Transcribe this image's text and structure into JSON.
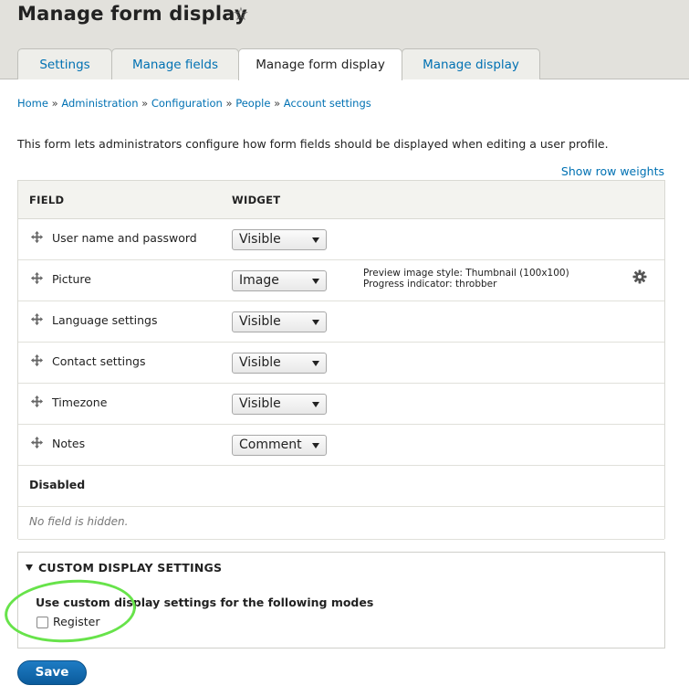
{
  "header": {
    "title": "Manage form display",
    "tabs": [
      {
        "label": "Settings",
        "active": false
      },
      {
        "label": "Manage fields",
        "active": false
      },
      {
        "label": "Manage form display",
        "active": true
      },
      {
        "label": "Manage display",
        "active": false
      }
    ]
  },
  "breadcrumb": [
    "Home",
    "Administration",
    "Configuration",
    "People",
    "Account settings"
  ],
  "breadcrumb_separator": "»",
  "description": "This form lets administrators configure how form fields should be displayed when editing a user profile.",
  "row_weights_link": "Show row weights",
  "table": {
    "headers": {
      "field": "FIELD",
      "widget": "WIDGET"
    },
    "rows": [
      {
        "label": "User name and password",
        "widget": "Visible",
        "summary": []
      },
      {
        "label": "Picture",
        "widget": "Image",
        "summary": [
          "Preview image style: Thumbnail (100x100)",
          "Progress indicator: throbber"
        ]
      },
      {
        "label": "Language settings",
        "widget": "Visible",
        "summary": []
      },
      {
        "label": "Contact settings",
        "widget": "Visible",
        "summary": []
      },
      {
        "label": "Timezone",
        "widget": "Visible",
        "summary": []
      },
      {
        "label": "Notes",
        "widget": "Comment",
        "summary": []
      }
    ],
    "disabled_label": "Disabled",
    "no_hidden_message": "No field is hidden."
  },
  "custom_display": {
    "legend": "CUSTOM DISPLAY SETTINGS",
    "title": "Use custom display settings for the following modes",
    "checkbox_label": "Register",
    "checked": false
  },
  "save_label": "Save",
  "colors": {
    "link": "#0071b3",
    "highlight": "#67e34a",
    "button": "#0b5b9c"
  }
}
